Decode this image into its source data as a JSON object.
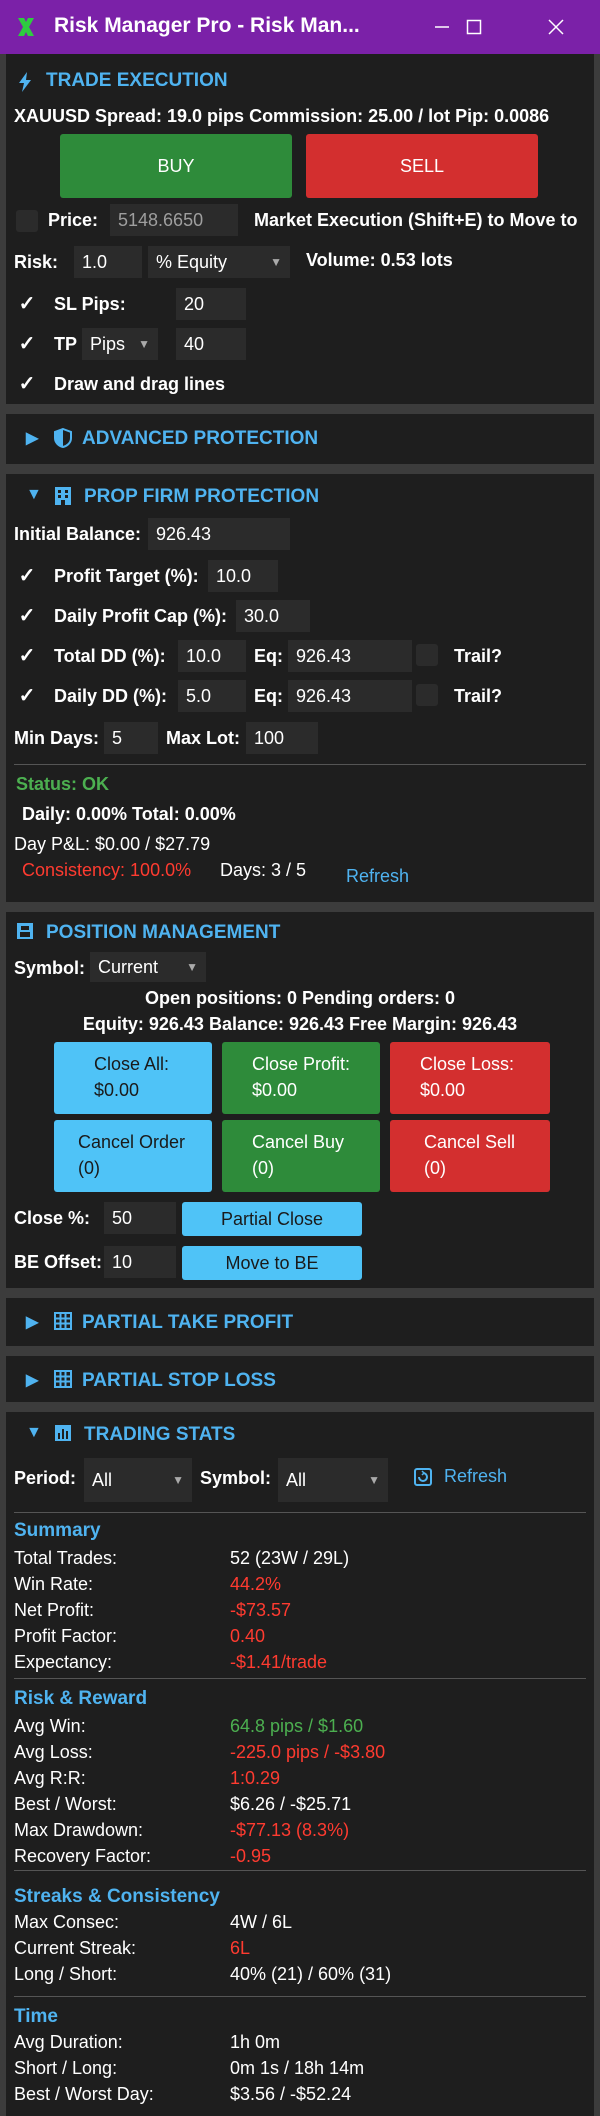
{
  "window": {
    "title": "Risk Manager Pro - Risk Man...",
    "title_bar_color": "#7b21a8",
    "min_icon": "minimize-icon",
    "max_icon": "maximize-icon",
    "close_icon": "close-icon"
  },
  "trade_execution": {
    "header": "TRADE EXECUTION",
    "info_line": "XAUUSD   Spread: 19.0 pips   Commission: 25.00 / lot   Pip: 0.0086",
    "buy_label": "BUY",
    "sell_label": "SELL",
    "price_label": "Price:",
    "price_value": "5148.6650",
    "market_note": "Market Execution (Shift+E) to Move to",
    "risk_label": "Risk:",
    "risk_value": "1.0",
    "risk_mode": "% Equity",
    "volume_text": "Volume: 0.53 lots",
    "sl_label": "SL Pips:",
    "sl_value": "20",
    "tp_label": "TP",
    "tp_mode": "Pips",
    "tp_value": "40",
    "draw_label": "Draw and drag lines"
  },
  "advanced_protection": {
    "header": "ADVANCED PROTECTION"
  },
  "prop_firm": {
    "header": "PROP FIRM PROTECTION",
    "initial_balance_label": "Initial Balance:",
    "initial_balance_value": "926.43",
    "profit_target_label": "Profit Target (%):",
    "profit_target_value": "10.0",
    "daily_cap_label": "Daily Profit Cap (%):",
    "daily_cap_value": "30.0",
    "total_dd_label": "Total DD (%):",
    "total_dd_value": "10.0",
    "eq_label": "Eq:",
    "total_eq_value": "926.43",
    "trail_label": "Trail?",
    "daily_dd_label": "Daily DD (%):",
    "daily_dd_value": "5.0",
    "daily_eq_value": "926.43",
    "min_days_label": "Min Days:",
    "min_days_value": "5",
    "max_lot_label": "Max Lot:",
    "max_lot_value": "100",
    "status_text": "Status: OK",
    "daily_total_text": "Daily: 0.00%   Total: 0.00%",
    "day_pl_text": "Day P&L: $0.00 / $27.79",
    "consistency_text": "Consistency: 100.0%",
    "days_text": "Days: 3 / 5",
    "refresh_label": "Refresh"
  },
  "position_mgmt": {
    "header": "POSITION MANAGEMENT",
    "symbol_label": "Symbol:",
    "symbol_value": "Current",
    "open_positions_text": "Open positions: 0   Pending orders: 0",
    "equity_line": "Equity: 926.43   Balance: 926.43   Free Margin: 926.43",
    "close_all_label": "Close All:",
    "close_all_value": "$0.00",
    "close_profit_label": "Close Profit:",
    "close_profit_value": "$0.00",
    "close_loss_label": "Close Loss:",
    "close_loss_value": "$0.00",
    "cancel_order_label": "Cancel Order",
    "cancel_order_value": "(0)",
    "cancel_buy_label": "Cancel Buy",
    "cancel_buy_value": "(0)",
    "cancel_sell_label": "Cancel Sell",
    "cancel_sell_value": "(0)",
    "close_pct_label": "Close %:",
    "close_pct_value": "50",
    "partial_close_label": "Partial Close",
    "be_offset_label": "BE Offset:",
    "be_offset_value": "10",
    "move_be_label": "Move to BE"
  },
  "partial_tp": {
    "header": "PARTIAL TAKE PROFIT"
  },
  "partial_sl": {
    "header": "PARTIAL STOP LOSS"
  },
  "trading_stats": {
    "header": "TRADING STATS",
    "period_label": "Period:",
    "period_value": "All",
    "symbol_label": "Symbol:",
    "symbol_value": "All",
    "refresh_label": "Refresh",
    "summary_title": "Summary",
    "summary": [
      {
        "label": "Total Trades:",
        "value": "52 (23W / 29L)",
        "color": "#ffffff"
      },
      {
        "label": "Win Rate:",
        "value": "44.2%",
        "color": "#ff3b30"
      },
      {
        "label": "Net Profit:",
        "value": "-$73.57",
        "color": "#ff3b30"
      },
      {
        "label": "Profit Factor:",
        "value": "0.40",
        "color": "#ff3b30"
      },
      {
        "label": "Expectancy:",
        "value": "-$1.41/trade",
        "color": "#ff3b30"
      }
    ],
    "risk_title": "Risk & Reward",
    "risk": [
      {
        "label": "Avg Win:",
        "value": "64.8 pips / $1.60",
        "color": "#4caf50"
      },
      {
        "label": "Avg Loss:",
        "value": "-225.0 pips / -$3.80",
        "color": "#ff3b30"
      },
      {
        "label": "Avg R:R:",
        "value": "1:0.29",
        "color": "#ff3b30"
      },
      {
        "label": "Best / Worst:",
        "value": "$6.26 / -$25.71",
        "color": "#ffffff"
      },
      {
        "label": "Max Drawdown:",
        "value": "-$77.13 (8.3%)",
        "color": "#ff3b30"
      },
      {
        "label": "Recovery Factor:",
        "value": "-0.95",
        "color": "#ff3b30"
      }
    ],
    "streaks_title": "Streaks & Consistency",
    "streaks": [
      {
        "label": "Max Consec:",
        "value": "4W / 6L",
        "color": "#ffffff"
      },
      {
        "label": "Current Streak:",
        "value": "6L",
        "color": "#ff3b30"
      },
      {
        "label": "Long / Short:",
        "value": "40% (21) / 60% (31)",
        "color": "#ffffff"
      }
    ],
    "time_title": "Time",
    "time": [
      {
        "label": "Avg Duration:",
        "value": "1h 0m",
        "color": "#ffffff"
      },
      {
        "label": "Short / Long:",
        "value": "0m 1s / 18h 14m",
        "color": "#ffffff"
      },
      {
        "label": "Best / Worst Day:",
        "value": "$3.56 / -$52.24",
        "color": "#ffffff"
      }
    ]
  }
}
